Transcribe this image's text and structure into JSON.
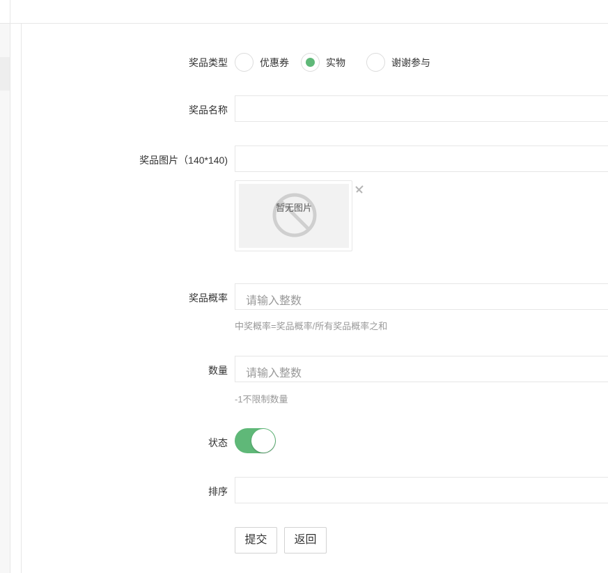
{
  "form": {
    "prize_type": {
      "label": "奖品类型",
      "options": [
        "优惠券",
        "实物",
        "谢谢参与"
      ],
      "selected": "实物"
    },
    "prize_name": {
      "label": "奖品名称",
      "value": ""
    },
    "prize_image": {
      "label": "奖品图片（140*140)",
      "value": "",
      "no_image_text": "暂无图片"
    },
    "prize_probability": {
      "label": "奖品概率",
      "placeholder": "请输入整数",
      "hint": "中奖概率=奖品概率/所有奖品概率之和"
    },
    "quantity": {
      "label": "数量",
      "placeholder": "请输入整数",
      "hint": "-1不限制数量"
    },
    "status": {
      "label": "状态",
      "on": true
    },
    "sort": {
      "label": "排序",
      "value": ""
    },
    "submit_label": "提交",
    "back_label": "返回"
  },
  "colors": {
    "accent": "#5fb878",
    "border": "#e6e6e6",
    "hint": "#999999"
  },
  "icons": [
    "no-image-icon",
    "close-icon"
  ]
}
